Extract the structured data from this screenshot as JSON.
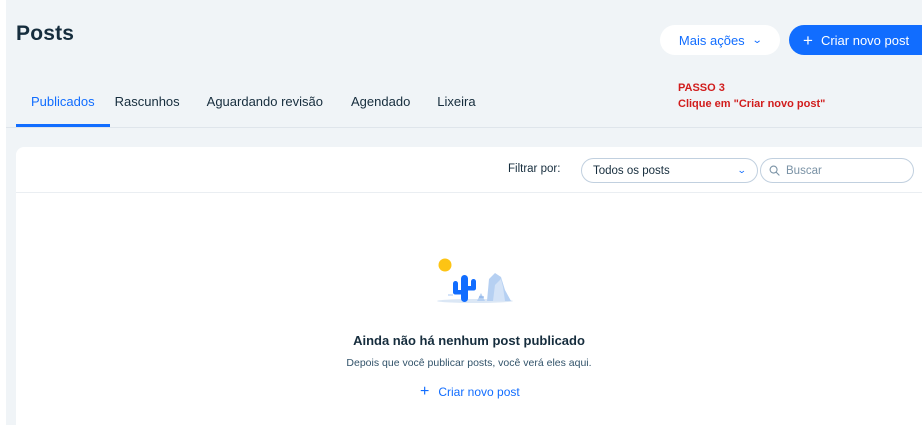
{
  "header": {
    "title": "Posts",
    "more_actions_label": "Mais ações",
    "create_post_label": "Criar novo post"
  },
  "tabs": [
    {
      "label": "Publicados",
      "active": true
    },
    {
      "label": "Rascunhos",
      "active": false
    },
    {
      "label": "Aguardando revisão",
      "active": false
    },
    {
      "label": "Agendado",
      "active": false
    },
    {
      "label": "Lixeira",
      "active": false
    }
  ],
  "annotation": {
    "step": "PASSO 3",
    "instruction": "Clique em \"Criar novo post\""
  },
  "toolbar": {
    "filter_label": "Filtrar por:",
    "filter_selected": "Todos os posts",
    "search_placeholder": "Buscar"
  },
  "empty_state": {
    "title": "Ainda não há nenhum post publicado",
    "subtitle": "Depois que você publicar posts, você verá eles aqui.",
    "create_link_label": "Criar novo post",
    "illustration": "desert-cactus-illustration"
  },
  "colors": {
    "accent": "#116dff",
    "page_background": "#f0f4f7",
    "text": "#162d3d",
    "annotation": "#d11c1c",
    "sun": "#fdc414",
    "cactus": "#116dff"
  }
}
